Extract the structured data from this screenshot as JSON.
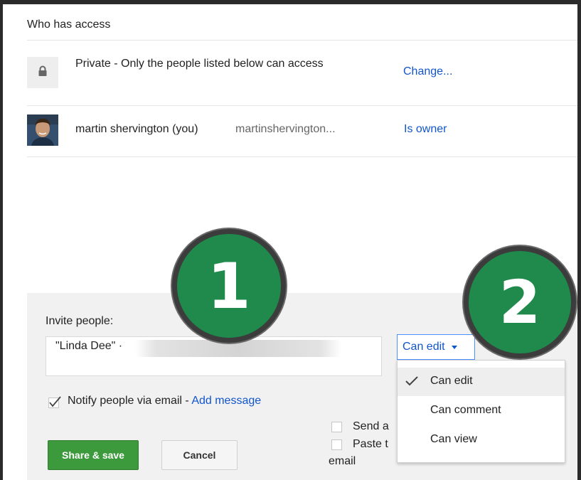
{
  "header": {
    "title": "Who has access"
  },
  "access": {
    "privacy": {
      "text": "Private - Only the people listed below can access",
      "change_label": "Change...",
      "icon": "lock-icon"
    },
    "owner": {
      "name": "martin shervington (you)",
      "email": "martinshervington...",
      "role": "Is owner"
    }
  },
  "invite": {
    "label": "Invite people:",
    "token": "\"Linda Dee\" ·",
    "permission": {
      "current": "Can edit",
      "options": [
        "Can edit",
        "Can comment",
        "Can view"
      ],
      "selected_index": 0
    },
    "notify": {
      "checked": true,
      "label": "Notify people via email - ",
      "add_message": "Add message"
    },
    "extra_options": {
      "send_label": "Send a",
      "paste_label": "Paste t",
      "email_label": "email"
    },
    "share_button": "Share & save",
    "cancel_button": "Cancel"
  },
  "annotations": [
    "1",
    "2"
  ],
  "colors": {
    "link": "#1155cc",
    "share_green": "#3d9a3c",
    "badge_green": "#1f8a4c"
  }
}
